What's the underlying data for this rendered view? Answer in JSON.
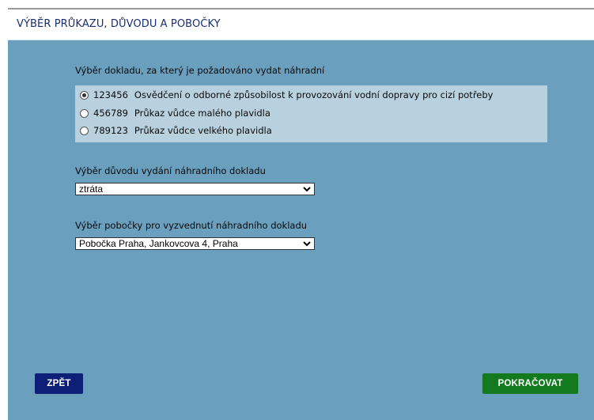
{
  "header": {
    "title": "VÝBĚR PRŮKAZU, DŮVODU A POBOČKY"
  },
  "document_section": {
    "label": "Výběr dokladu, za který je požadováno vydat náhradní",
    "options": [
      {
        "code": "123456",
        "name": "Osvědčení o odborné způsobilost k provozování vodní dopravy pro cizí potřeby",
        "selected": true
      },
      {
        "code": "456789",
        "name": "Průkaz vůdce malého plavidla",
        "selected": false
      },
      {
        "code": "789123",
        "name": "Průkaz vůdce velkého plavidla",
        "selected": false
      }
    ]
  },
  "reason_section": {
    "label": "Výběr důvodu vydání náhradního dokladu",
    "selected_value": "ztráta"
  },
  "branch_section": {
    "label": "Výběr pobočky pro vyzvednutí náhradního dokladu",
    "selected_value": "Pobočka Praha, Jankovcova 4, Praha"
  },
  "buttons": {
    "back_label": "ZPĚT",
    "next_label": "POKRAČOVAT"
  },
  "colors": {
    "background": "#6a9fbe",
    "header_text": "#1a2e6e",
    "back_button": "#0e1f78",
    "next_button": "#147a1f",
    "option_box": "#b9d1de"
  },
  "icons": {
    "select_arrow": "chevron-down-icon"
  }
}
